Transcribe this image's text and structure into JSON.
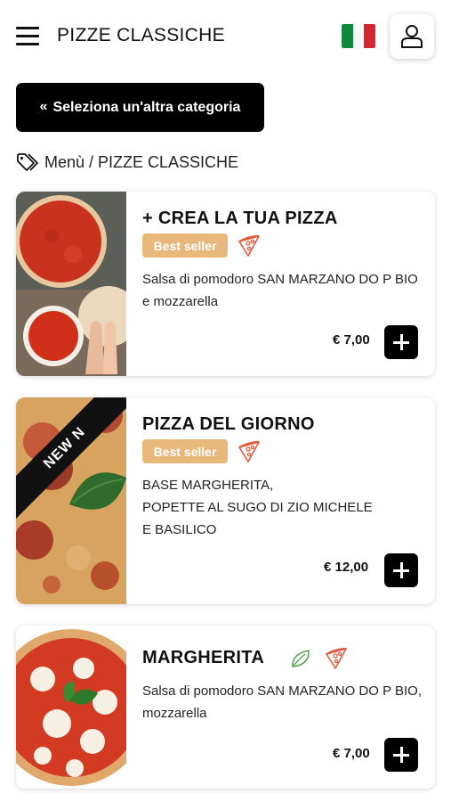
{
  "header": {
    "title": "PIZZE CLASSICHE",
    "language_flag": "it"
  },
  "category_button": {
    "chevron": "«",
    "label": "Seleziona un'altra categoria"
  },
  "breadcrumb": {
    "text": "Menù / PIZZE CLASSICHE"
  },
  "products": [
    {
      "title": "+ CREA LA TUA PIZZA",
      "badge": "Best seller",
      "description": "Salsa di pomodoro SAN MARZANO DO P BIO e mozzarella",
      "price": "€ 7,00"
    },
    {
      "title": "PIZZA DEL GIORNO",
      "badge": "Best seller",
      "ribbon": "NEW N",
      "description_lines": [
        "BASE MARGHERITA,",
        "POPETTE AL SUGO DI ZIO MICHELE",
        "E BASILICO"
      ],
      "price": "€ 12,00"
    },
    {
      "title": "MARGHERITA",
      "description": "Salsa di pomodoro SAN MARZANO DO P BIO, mozzarella",
      "price": "€ 7,00"
    }
  ],
  "colors": {
    "badge": "#e8b77a",
    "pizza_icon": "#e05a3e",
    "leaf_icon": "#5aa55a",
    "button": "#000000"
  }
}
